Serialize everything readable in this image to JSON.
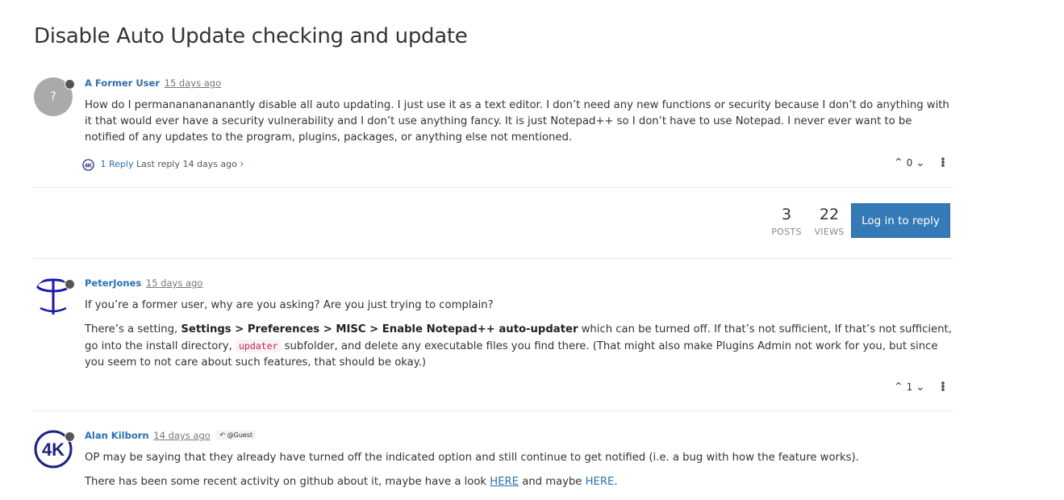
{
  "topic": {
    "title": "Disable Auto Update checking and update"
  },
  "stats": {
    "posts_count": "3",
    "posts_label": "POSTS",
    "views_count": "22",
    "views_label": "VIEWS"
  },
  "actions": {
    "login_label": "Log in to reply"
  },
  "posts": [
    {
      "author": "A Former User",
      "timestamp": "15 days ago",
      "avatar_letter": "?",
      "paragraphs": [
        "How do I permanananananantly disable all auto updating. I just use it as a text editor. I don’t need any new functions or security because I don’t do anything with it that would ever have a security vulnerability and I don’t use anything fancy. It is just Notepad++ so I don’t have to use Notepad. I never ever want to be notified of any updates to the program, plugins, packages, or anything else not mentioned."
      ],
      "votes": "0",
      "replies": {
        "count_label": "1 Reply",
        "last_reply": "Last reply 14 days ago"
      }
    },
    {
      "author": "PeterJones",
      "timestamp": "15 days ago",
      "paragraph1": "If you’re a former user, why are you asking? Are you just trying to complain?",
      "p2_start": "There’s a setting, ",
      "p2_bold": "Settings > Preferences > MISC > Enable Notepad++ auto-updater",
      "p2_mid": " which can be turned off. If that’s not sufficient, If that’s not sufficient, go into the install directory, ",
      "p2_code": "updater",
      "p2_end": " subfolder, and delete any executable files you find there. (That might also make Plugins Admin not work for you, but since you seem to not care about such features, that should be okay.)",
      "votes": "1"
    },
    {
      "author": "Alan Kilborn",
      "timestamp": "14 days ago",
      "reply_to": "@Guest",
      "paragraph1": "OP may be saying that they already have turned off the indicated option and still continue to get notified (i.e. a bug with how the feature works).",
      "p2_start": "There has been some recent activity on github about it, maybe have a look ",
      "link1": "HERE",
      "p2_mid": " and maybe ",
      "link2": "HERE",
      "p2_end": "."
    }
  ],
  "colors": {
    "accent": "#337ab7",
    "username": "#2a6fb0",
    "text": "#333333"
  }
}
